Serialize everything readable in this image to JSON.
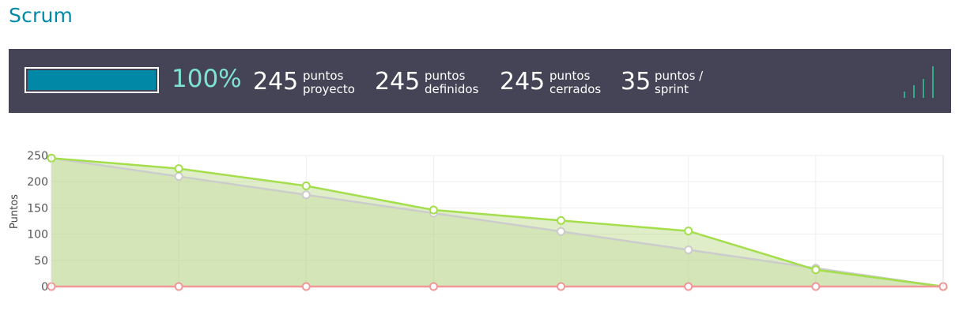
{
  "header": {
    "title": "Scrum"
  },
  "summary": {
    "progress_percent": 100,
    "percent_label": "100%",
    "stats": [
      {
        "value": "245",
        "line1": "puntos",
        "line2": "proyecto"
      },
      {
        "value": "245",
        "line1": "puntos",
        "line2": "definidos"
      },
      {
        "value": "245",
        "line1": "puntos",
        "line2": "cerrados"
      },
      {
        "value": "35",
        "line1": "puntos /",
        "line2": "sprint"
      }
    ],
    "icon": "signal-bars-icon"
  },
  "chart_data": {
    "type": "area",
    "ylabel": "Puntos",
    "xlabel": "",
    "ylim": [
      0,
      250
    ],
    "yticks": [
      0,
      50,
      100,
      150,
      200,
      250
    ],
    "x": [
      0,
      1,
      2,
      3,
      4,
      5,
      6,
      7
    ],
    "grid": true,
    "legend": "none",
    "series": [
      {
        "values": [
          245,
          225,
          192,
          146,
          126,
          106,
          32,
          0
        ],
        "color": "#a4de4c"
      },
      {
        "values": [
          245,
          210,
          175,
          140,
          105,
          70,
          35,
          0
        ],
        "color": "#cccccc"
      },
      {
        "values": [
          0,
          0,
          0,
          0,
          0,
          0,
          0,
          0
        ],
        "color": "#f09898"
      }
    ]
  }
}
